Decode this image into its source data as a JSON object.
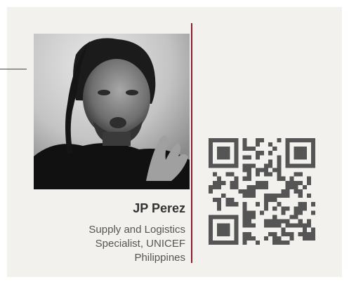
{
  "profile": {
    "name": "JP Perez",
    "role_line1": "Supply and Logistics",
    "role_line2": "Specialist, UNICEF",
    "role_line3": "Philippines"
  },
  "colors": {
    "background": "#f2f1ed",
    "divider": "#8b1a2b",
    "qr": "#555555"
  },
  "icons": {
    "qr": "qr-code-icon",
    "photo": "portrait-photo"
  }
}
